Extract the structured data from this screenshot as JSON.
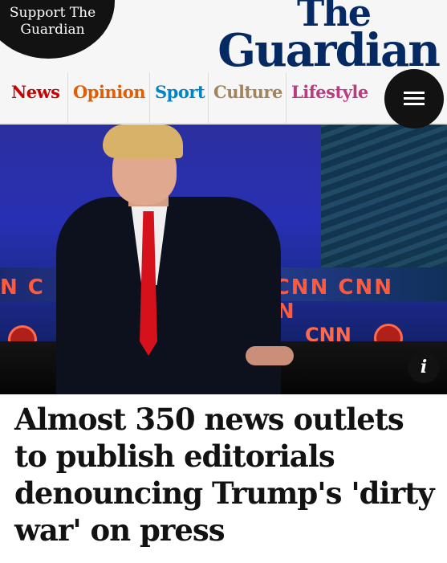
{
  "header": {
    "support_line1": "Support The",
    "support_line2": "Guardian",
    "logo_line1": "The",
    "logo_line2": "Guardian"
  },
  "nav": {
    "items": [
      {
        "label": "News",
        "color": "#c70000"
      },
      {
        "label": "Opinion",
        "color": "#e05e00"
      },
      {
        "label": "Sport",
        "color": "#0084c6"
      },
      {
        "label": "Culture",
        "color": "#a1845c"
      },
      {
        "label": "Lifestyle",
        "color": "#bb3b80"
      }
    ],
    "menu_icon": "hamburger-menu-icon"
  },
  "hero": {
    "backdrop_text_row1": "N C            W CNN CNN CNN",
    "backdrop_text_row2": "CNN",
    "info_label": "i"
  },
  "article": {
    "headline": "Almost 350 news outlets to publish editorials denouncing Trump's 'dirty war' on press"
  },
  "colors": {
    "brand": "#052962",
    "header_bg": "#f6f6f6",
    "dark": "#121212"
  }
}
